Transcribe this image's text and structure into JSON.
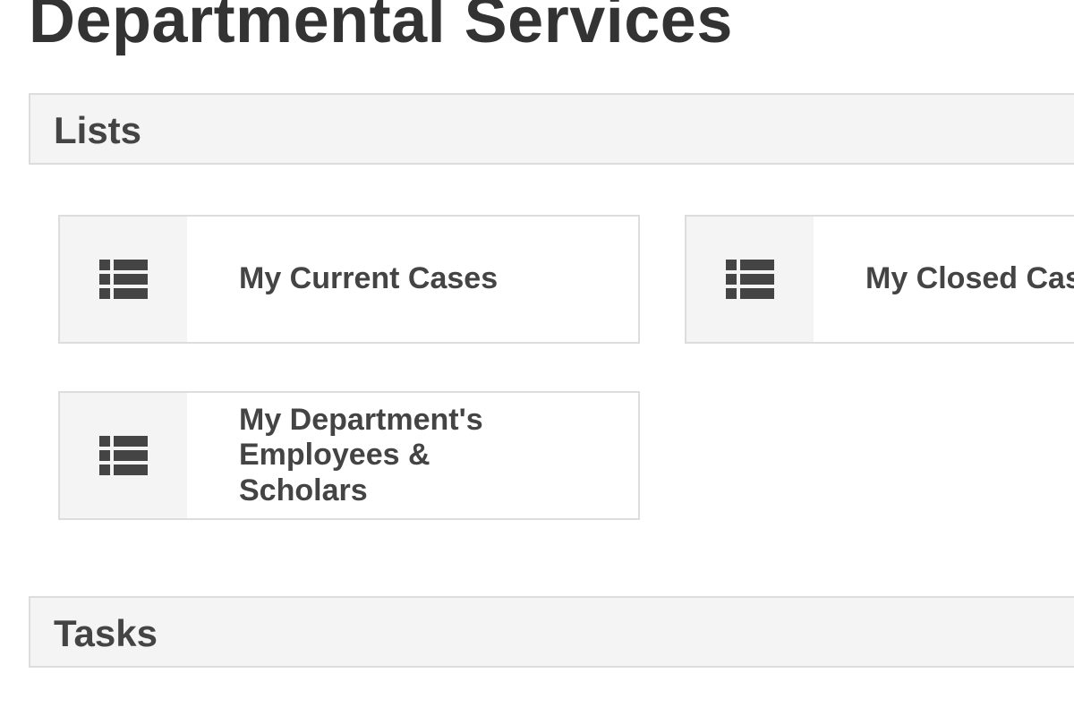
{
  "page": {
    "title": "Departmental Services"
  },
  "sections": {
    "lists": {
      "title": "Lists",
      "items": [
        {
          "label": "My Current Cases",
          "icon": "list-icon"
        },
        {
          "label": "My Closed Cases",
          "icon": "list-icon"
        },
        {
          "label": "My Department's\nEmployees &\nScholars",
          "icon": "list-icon"
        }
      ]
    },
    "tasks": {
      "title": "Tasks"
    }
  },
  "colors": {
    "text": "#333333",
    "header_bg": "#f4f4f4",
    "border": "#dddddd",
    "icon": "#444444"
  }
}
